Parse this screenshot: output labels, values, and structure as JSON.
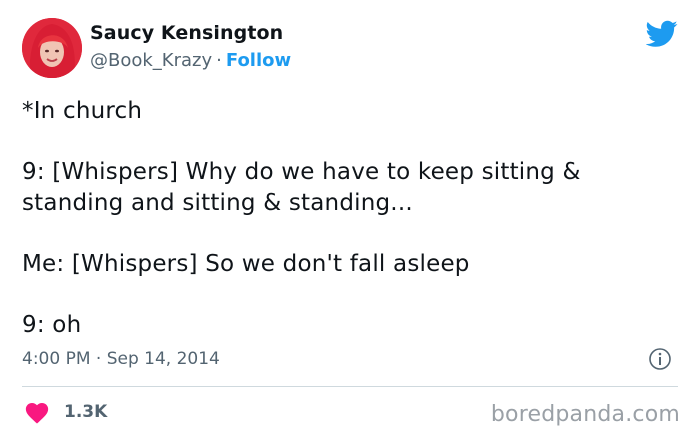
{
  "author": {
    "display_name": "Saucy Kensington",
    "handle": "@Book_Krazy",
    "separator": "·",
    "follow_label": "Follow"
  },
  "tweet": {
    "lines": [
      "*In church",
      "9: [Whispers] Why do we have to keep sitting & standing and sitting & standing...",
      "Me: [Whispers] So we don't fall asleep",
      "9: oh"
    ],
    "time": "4:00 PM",
    "date_separator": "·",
    "date": "Sep 14, 2014"
  },
  "engagement": {
    "like_count": "1.3K"
  },
  "watermark": "boredpanda.com",
  "colors": {
    "accent": "#1d9bf0",
    "like": "#f91880",
    "muted": "#536471"
  },
  "icons": {
    "brand": "twitter-bird-icon",
    "info": "info-icon",
    "like": "heart-icon"
  }
}
